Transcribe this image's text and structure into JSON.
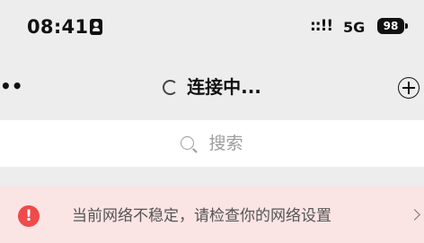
{
  "status_bar": {
    "time": "08:41",
    "signal": "::!!",
    "network": "5G",
    "battery": "98"
  },
  "nav": {
    "more": "••",
    "title": "连接中..."
  },
  "search": {
    "placeholder": "搜索"
  },
  "warning": {
    "icon": "!",
    "message": "当前网络不稳定，请检查你的网络设置",
    "accent": "#f04a4a",
    "background": "#fbe4e4"
  }
}
